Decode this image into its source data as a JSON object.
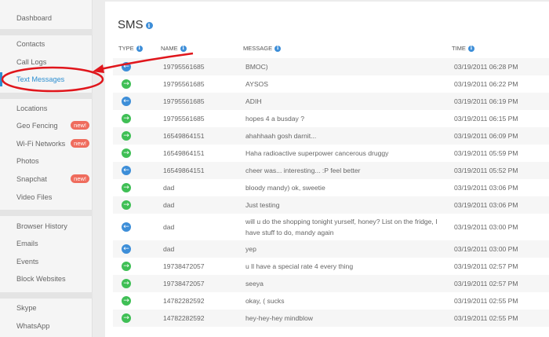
{
  "sidebar": {
    "items": [
      {
        "label": "Dashboard"
      },
      {
        "label": "Contacts"
      },
      {
        "label": "Call Logs"
      },
      {
        "label": "Text Messages",
        "active": true
      },
      {
        "label": "Locations"
      },
      {
        "label": "Geo Fencing",
        "badge": "new!"
      },
      {
        "label": "Wi-Fi Networks",
        "badge": "new!"
      },
      {
        "label": "Photos"
      },
      {
        "label": "Snapchat",
        "badge": "new!"
      },
      {
        "label": "Video Files"
      },
      {
        "label": "Browser History"
      },
      {
        "label": "Emails"
      },
      {
        "label": "Events"
      },
      {
        "label": "Block Websites"
      },
      {
        "label": "Skype"
      },
      {
        "label": "WhatsApp"
      }
    ]
  },
  "main": {
    "title": "SMS",
    "info_glyph": "i",
    "columns": {
      "type": "TYPE",
      "name": "NAME",
      "message": "MESSAGE",
      "time": "TIME"
    },
    "rows": [
      {
        "dir": "incoming",
        "name": "19795561685",
        "message": "BMOC)",
        "time": "03/19/2011 06:28 PM"
      },
      {
        "dir": "outgoing",
        "name": "19795561685",
        "message": "AYSOS",
        "time": "03/19/2011 06:22 PM"
      },
      {
        "dir": "incoming",
        "name": "19795561685",
        "message": "ADIH",
        "time": "03/19/2011 06:19 PM"
      },
      {
        "dir": "outgoing",
        "name": "19795561685",
        "message": "hopes 4 a busday ?",
        "time": "03/19/2011 06:15 PM"
      },
      {
        "dir": "outgoing",
        "name": "16549864151",
        "message": "ahahhaah gosh darnit...",
        "time": "03/19/2011 06:09 PM"
      },
      {
        "dir": "outgoing",
        "name": "16549864151",
        "message": "Haha radioactive superpower cancerous druggy",
        "time": "03/19/2011 05:59 PM"
      },
      {
        "dir": "incoming",
        "name": "16549864151",
        "message": "cheer was... interesting... :P feel better",
        "time": "03/19/2011 05:52 PM"
      },
      {
        "dir": "outgoing",
        "name": "dad",
        "message": "bloody mandy) ok, sweetie",
        "time": "03/19/2011 03:06 PM"
      },
      {
        "dir": "outgoing",
        "name": "dad",
        "message": "Just testing",
        "time": "03/19/2011 03:06 PM"
      },
      {
        "dir": "incoming",
        "name": "dad",
        "message": "will u do the shopping tonight yurself, honey? List on the fridge, I have stuff to do, mandy again",
        "time": "03/19/2011 03:00 PM"
      },
      {
        "dir": "incoming",
        "name": "dad",
        "message": "yep",
        "time": "03/19/2011 03:00 PM"
      },
      {
        "dir": "outgoing",
        "name": "19738472057",
        "message": "u ll have a special rate 4 every thing",
        "time": "03/19/2011 02:57 PM"
      },
      {
        "dir": "outgoing",
        "name": "19738472057",
        "message": "seeya",
        "time": "03/19/2011 02:57 PM"
      },
      {
        "dir": "outgoing",
        "name": "14782282592",
        "message": "okay, ( sucks",
        "time": "03/19/2011 02:55 PM"
      },
      {
        "dir": "outgoing",
        "name": "14782282592",
        "message": "hey-hey-hey mindblow",
        "time": "03/19/2011 02:55 PM"
      }
    ]
  },
  "icons": {
    "incoming": "arrow-left-icon",
    "outgoing": "arrow-right-icon"
  },
  "colors": {
    "accent": "#2d8fd1",
    "incoming": "#3d8ed8",
    "outgoing": "#3fbf55",
    "badge": "#ef6c5d",
    "annotation": "#e0161c"
  }
}
